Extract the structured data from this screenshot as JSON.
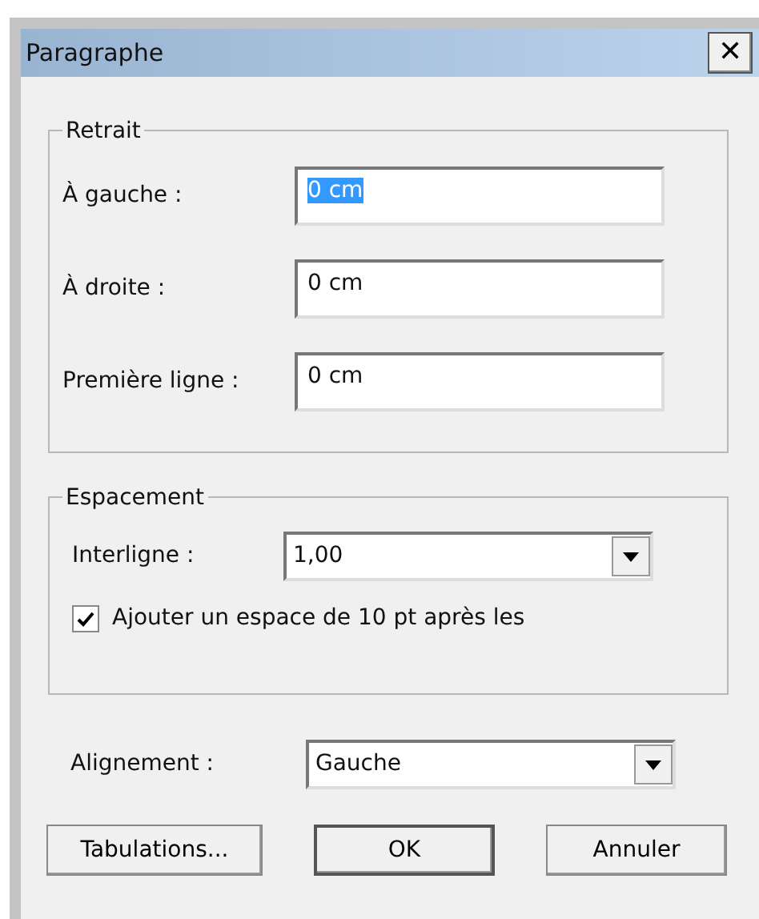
{
  "window": {
    "title": "Paragraphe",
    "close": "✕"
  },
  "retrait": {
    "legend": "Retrait",
    "fields": [
      {
        "label": "À gauche :",
        "value": "0 cm",
        "selected": true
      },
      {
        "label": "À droite :",
        "value": "0 cm",
        "selected": false
      },
      {
        "label": "Première ligne :",
        "value": "0 cm",
        "selected": false
      }
    ]
  },
  "espacement": {
    "legend": "Espacement",
    "interligne": {
      "label": "Interligne :",
      "value": "1,00"
    },
    "checkbox": {
      "label": "Ajouter un espace de 10 pt après les",
      "checked": true
    }
  },
  "alignement": {
    "label": "Alignement :",
    "value": "Gauche"
  },
  "buttons": [
    {
      "label": "Tabulations...",
      "default": false
    },
    {
      "label": "OK",
      "default": true
    },
    {
      "label": "Annuler",
      "default": false
    }
  ]
}
